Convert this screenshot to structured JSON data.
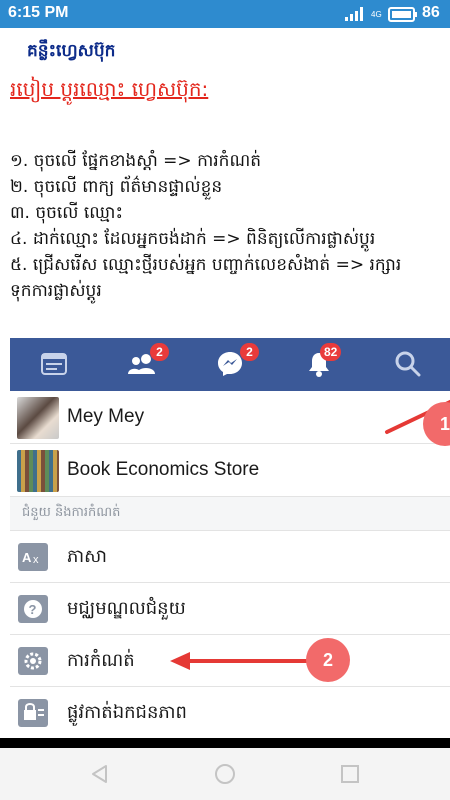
{
  "status_bar": {
    "time": "6:15 PM",
    "network": "4G",
    "battery": "86"
  },
  "article": {
    "brand": "គន្លឹះហ្វេសប៊ុក",
    "headline": "របៀប ប្ដូរឈ្មោះ ហ្វេសប៊ុក:",
    "steps": [
      "១. ចុចលើ ផ្នែកខាងស្ដាំ => ការកំណត់",
      "២. ចុចលើ ពាក្យ ព័ត៌មានផ្ទាល់ខ្លួន",
      "៣. ចុចលើ ឈ្មោះ",
      "៤. ដាក់ឈ្មោះ ដែលអ្នកចង់ដាក់ => ពិនិត្យលើការផ្លាស់ប្ដូរ",
      "៥. ជ្រើសរើស ឈ្មោះថ្មីរបស់អ្នក បញ្ចាក់លេខសំងាត់ => រក្សារ",
      "ទុកការផ្លាស់ប្ដូរ"
    ]
  },
  "facebook": {
    "nav_badges": {
      "friends": "2",
      "messenger": "2",
      "notifications": "82"
    },
    "profiles": [
      {
        "name": "Mey Mey"
      },
      {
        "name": "Book Economics Store"
      }
    ],
    "section_header": "ជំនួយ និងការកំណត់",
    "menu": [
      {
        "label": "ភាសា",
        "icon": "translate-icon"
      },
      {
        "label": "មជ្ឈមណ្ឌលជំនួយ",
        "icon": "help-icon"
      },
      {
        "label": "ការកំណត់",
        "icon": "gear-icon"
      },
      {
        "label": "ផ្លូវកាត់ឯកជនភាព",
        "icon": "privacy-lock-icon"
      }
    ],
    "markers": [
      "1",
      "2"
    ]
  },
  "colors": {
    "status_bar": "#2e8bcf",
    "fb_blue": "#3b5998",
    "headline_red": "#e3261c",
    "brand_blue": "#0d2c8a",
    "arrow_red": "#e53935",
    "marker": "#f26a6a"
  }
}
